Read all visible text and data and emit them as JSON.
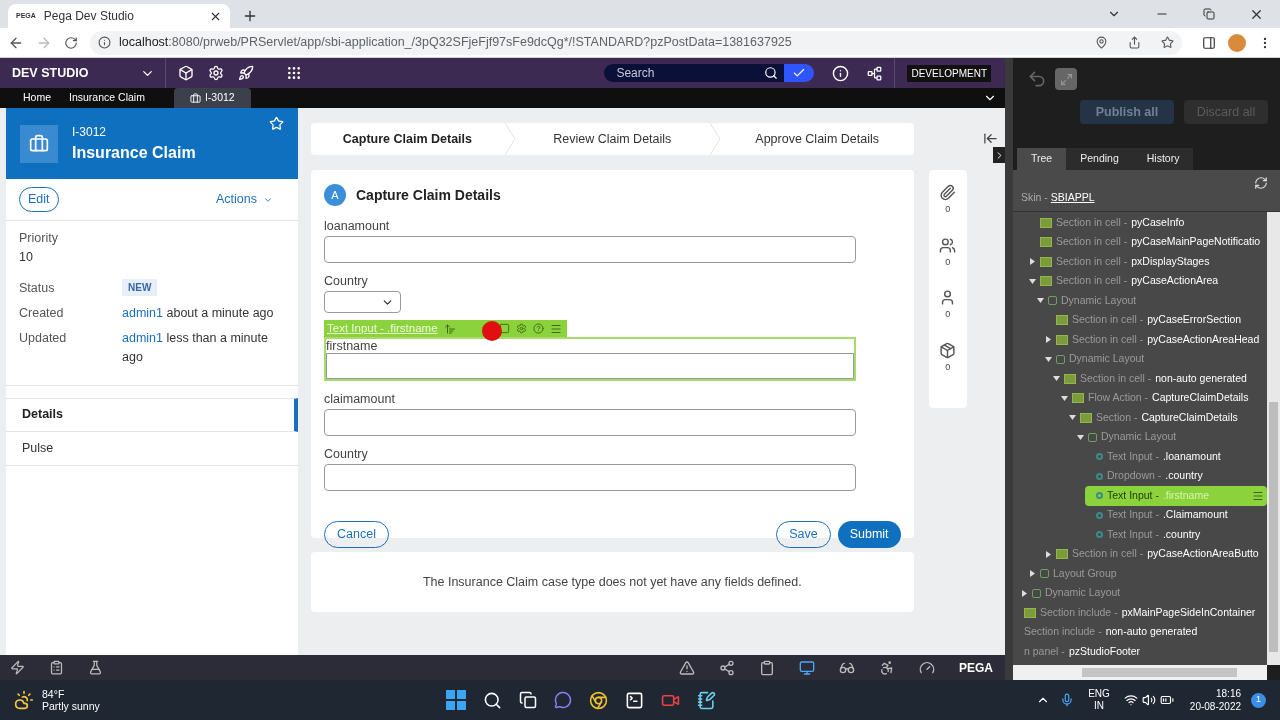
{
  "browser": {
    "favicon_text": "PEGA",
    "tab_title": "Pega Dev Studio",
    "url_host": "localhost",
    "url_rest": ":8080/prweb/PRServlet/app/sbi-application_/3pQ32SFjeFjf97sFe9dcQg*/!STANDARD?pzPostData=1381637925"
  },
  "header": {
    "title": "DEV STUDIO",
    "search": {
      "placeholder": "Search",
      "checked": true
    },
    "environment": "DEVELOPMENT"
  },
  "work_tabs": [
    {
      "label": "Home",
      "selected": false
    },
    {
      "label": "Insurance Claim",
      "selected": false
    },
    {
      "label": "I-3012",
      "selected": true
    }
  ],
  "case": {
    "id": "I-3012",
    "title": "Insurance Claim",
    "edit": "Edit",
    "actions": "Actions",
    "details": [
      {
        "kind": "stacked",
        "label": "Priority",
        "value": "10"
      },
      {
        "kind": "badge",
        "label": "Status",
        "value": "NEW"
      },
      {
        "kind": "user",
        "label": "Created",
        "user": "admin1",
        "time": "about a minute ago"
      },
      {
        "kind": "user",
        "label": "Updated",
        "user": "admin1",
        "time": "less than a minute ago"
      }
    ],
    "nav": [
      {
        "label": "Details",
        "selected": true
      },
      {
        "label": "Pulse",
        "selected": false
      }
    ]
  },
  "stages": [
    {
      "label": "Capture Claim Details",
      "selected": true
    },
    {
      "label": "Review Claim Details",
      "selected": false
    },
    {
      "label": "Approve Claim Details",
      "selected": false
    }
  ],
  "form": {
    "badge": "A",
    "title": "Capture Claim Details",
    "editor_bar": "Text Input - .firstname",
    "fields": [
      {
        "kind": "text",
        "label": "loanamount",
        "highlighted": false
      },
      {
        "kind": "dropdown",
        "label": "Country",
        "highlighted": false
      },
      {
        "kind": "text",
        "label": "firstname",
        "highlighted": true
      },
      {
        "kind": "text",
        "label": "claimamount",
        "highlighted": false
      },
      {
        "kind": "text",
        "label": "Country",
        "highlighted": false
      }
    ],
    "buttons": [
      {
        "label": "Cancel",
        "kind": "secondary"
      },
      {
        "label": "Save",
        "kind": "secondary"
      },
      {
        "label": "Submit",
        "kind": "primary"
      }
    ]
  },
  "message": "The Insurance Claim case type does not yet have any fields defined.",
  "utilities": [
    {
      "kind": "attachments",
      "count": "0"
    },
    {
      "kind": "followers",
      "count": "0"
    },
    {
      "kind": "stakeholders",
      "count": "0"
    },
    {
      "kind": "tags",
      "count": "0"
    }
  ],
  "studio_panel": {
    "publish": "Publish all",
    "discard": "Discard all",
    "tabs": [
      {
        "label": "Tree",
        "selected": true
      },
      {
        "label": "Pending",
        "selected": false
      },
      {
        "label": "History",
        "selected": false
      }
    ],
    "skin_label": "Skin -",
    "skin": "SBIAPPL",
    "tree": [
      {
        "children": [
          {
            "children": [
              {
                "type": "Section in cell -",
                "name": "pyCaseInfo",
                "kind": "section",
                "selected": false
              },
              {
                "type": "Section in cell -",
                "name": "pyCaseMainPageNotificatio",
                "kind": "section",
                "selected": false
              },
              {
                "type": "Section in cell -",
                "name": "pxDisplayStages",
                "kind": "section",
                "expanded": false,
                "selected": false
              },
              {
                "type": "Section in cell -",
                "name": "pyCaseActionArea",
                "kind": "section",
                "expanded": true,
                "selected": false,
                "children": [
                  {
                    "type": "Dynamic Layout",
                    "kind": "layout",
                    "expanded": true,
                    "selected": false,
                    "children": [
                      {
                        "type": "Section in cell -",
                        "name": "pyCaseErrorSection",
                        "kind": "section",
                        "selected": false
                      },
                      {
                        "type": "Section in cell -",
                        "name": "pyCaseActionAreaHead",
                        "kind": "section",
                        "expanded": false,
                        "selected": false
                      },
                      {
                        "type": "Dynamic Layout",
                        "kind": "layout",
                        "expanded": true,
                        "selected": false,
                        "children": [
                          {
                            "type": "Section in cell -",
                            "name": "non-auto generated",
                            "kind": "section",
                            "expanded": true,
                            "selected": false,
                            "children": [
                              {
                                "type": "Flow Action -",
                                "name": "CaptureClaimDetails",
                                "kind": "section",
                                "expanded": true,
                                "selected": false,
                                "children": [
                                  {
                                    "type": "Section -",
                                    "name": "CaptureClaimDetails",
                                    "kind": "section",
                                    "expanded": true,
                                    "selected": false,
                                    "children": [
                                      {
                                        "type": "Dynamic Layout",
                                        "kind": "layout",
                                        "expanded": true,
                                        "selected": false,
                                        "children": [
                                          {
                                            "type": "Text Input -",
                                            "name": ".loanamount",
                                            "kind": "control",
                                            "selected": false
                                          },
                                          {
                                            "type": "Dropdown -",
                                            "name": ".country",
                                            "kind": "control",
                                            "selected": false
                                          },
                                          {
                                            "type": "Text Input -",
                                            "name": ".firstname",
                                            "kind": "control",
                                            "selected": true
                                          },
                                          {
                                            "type": "Text Input -",
                                            "name": ".Claimamount",
                                            "kind": "control",
                                            "selected": false
                                          },
                                          {
                                            "type": "Text Input -",
                                            "name": ".country",
                                            "kind": "control",
                                            "selected": false
                                          }
                                        ]
                                      }
                                    ]
                                  }
                                ]
                              }
                            ]
                          }
                        ]
                      },
                      {
                        "type": "Section in cell -",
                        "name": "pyCaseActionAreaButto",
                        "kind": "section",
                        "expanded": false,
                        "selected": false
                      }
                    ]
                  }
                ]
              },
              {
                "type": "Layout Group",
                "kind": "layout",
                "expanded": false,
                "selected": false
              }
            ]
          },
          {
            "type": "Dynamic Layout",
            "kind": "layout",
            "expanded": false,
            "selected": false
          }
        ]
      },
      {
        "type": "Section include -",
        "name": "pxMainPageSideInContainer",
        "kind": "section",
        "selected": false
      },
      {
        "type": "Section include -",
        "name": "non-auto generated",
        "kind": "plain",
        "selected": false
      },
      {
        "type": "n panel -",
        "name": "pzStudioFooter",
        "kind": "plain",
        "selected": false
      }
    ]
  },
  "footer": {
    "brand": "PEGA"
  },
  "taskbar": {
    "temperature": "84°F",
    "weather": "Partly sunny",
    "language": "ENG",
    "region": "IN",
    "time": "18:16",
    "date": "20-08-2022",
    "notifications": "1"
  }
}
